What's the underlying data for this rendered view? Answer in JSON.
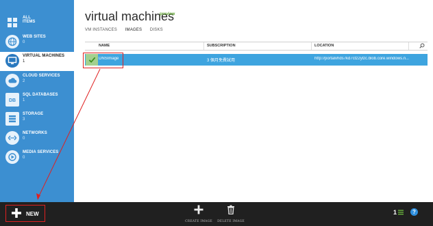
{
  "sidebar": {
    "items": [
      {
        "label": "ALL",
        "label2": "ITEMS",
        "count": "",
        "icon": "grid-icon"
      },
      {
        "label": "WEB SITES",
        "count": "0",
        "icon": "globe-icon"
      },
      {
        "label": "VIRTUAL MACHINES",
        "count": "1",
        "icon": "monitor-icon"
      },
      {
        "label": "CLOUD SERVICES",
        "count": "2",
        "icon": "cloud-icon"
      },
      {
        "label": "SQL DATABASES",
        "count": "1",
        "icon": "database-icon"
      },
      {
        "label": "STORAGE",
        "count": "3",
        "icon": "storage-icon"
      },
      {
        "label": "NETWORKS",
        "count": "0",
        "icon": "network-icon"
      },
      {
        "label": "MEDIA SERVICES",
        "count": "0",
        "icon": "media-icon"
      }
    ]
  },
  "main": {
    "title": "virtual machines",
    "badge": "preview",
    "tabs": [
      "VM INSTANCES",
      "IMAGES",
      "DISKS"
    ],
    "selected_tab": "IMAGES"
  },
  "table": {
    "columns": [
      "NAME",
      "SUBSCRIPTION",
      "LOCATION"
    ],
    "rows": [
      {
        "name": "DNSImage",
        "subscription": "3 個月免費試用",
        "location": "http://portalvhds7kd7ctz2ylzc.blob.core.windows.n..."
      }
    ]
  },
  "bottombar": {
    "new_label": "NEW",
    "commands": [
      {
        "label": "CREATE IMAGE",
        "icon": "plus-icon"
      },
      {
        "label": "DELETE IMAGE",
        "icon": "trash-icon"
      }
    ],
    "count_label": "1",
    "help_label": "?"
  },
  "colors": {
    "sidebar": "#3c8fd1",
    "selected_row": "#3ea4df",
    "preview": "#5aa02c",
    "bottombar": "#202020",
    "annotation": "#e02020"
  }
}
